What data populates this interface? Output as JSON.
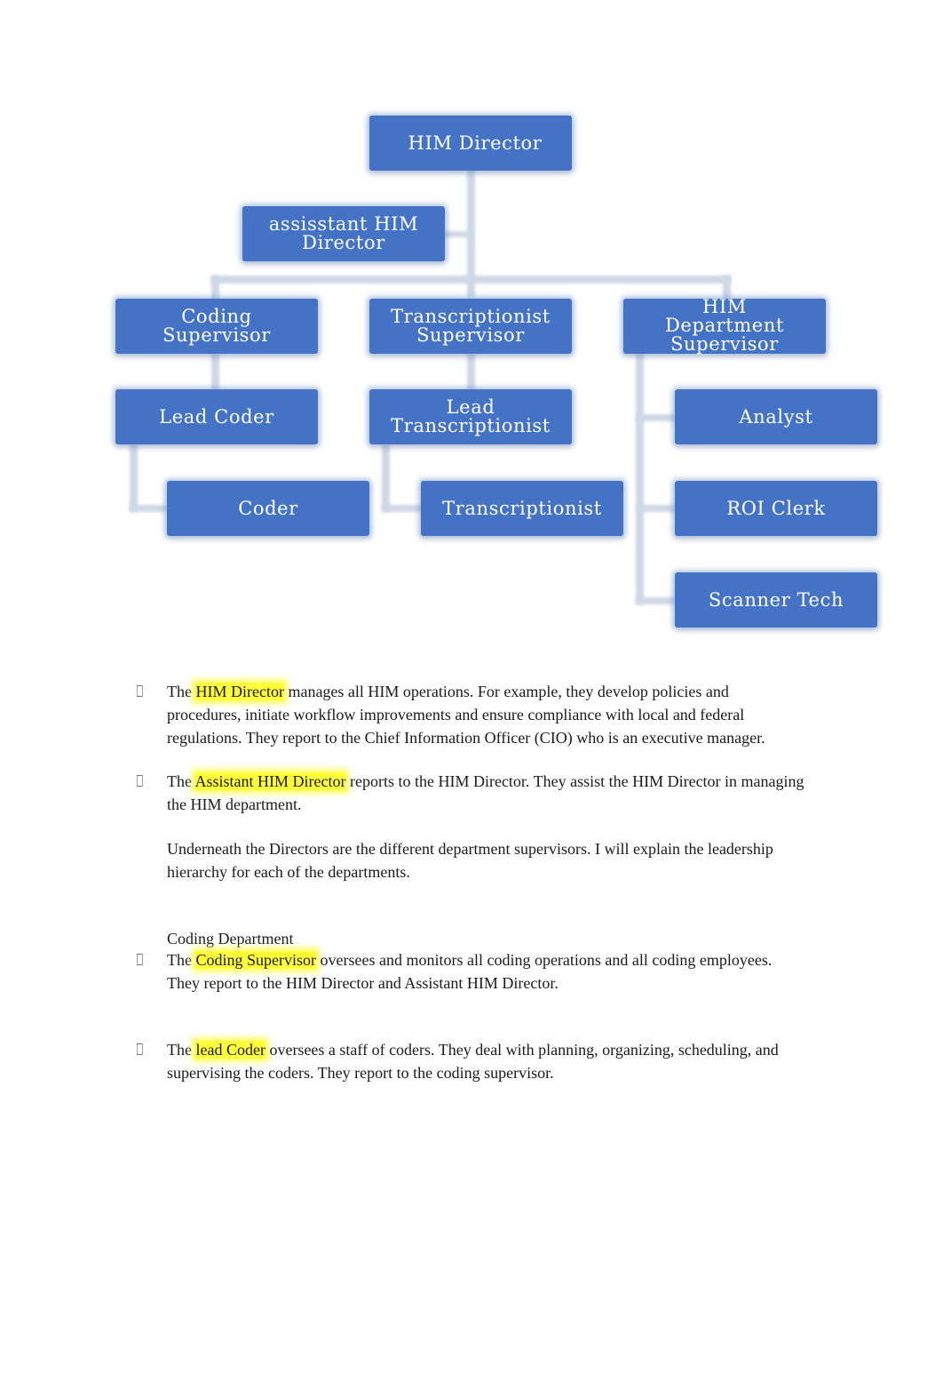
{
  "org_chart": {
    "node_color": "#4472c4",
    "connector_color": "#cfd8e6",
    "nodes": {
      "him_director": {
        "lines": [
          "HIM Director"
        ]
      },
      "assistant_director": {
        "lines": [
          "assisstant HIM",
          "Director"
        ]
      },
      "coding_supervisor": {
        "lines": [
          "Coding",
          "Supervisor"
        ]
      },
      "transcriptionist_supervisor": {
        "lines": [
          "Transcriptionist",
          "Supervisor"
        ]
      },
      "him_department_supervisor": {
        "lines": [
          "HIM",
          "Department",
          "Supervisor"
        ]
      },
      "lead_coder": {
        "lines": [
          "Lead Coder"
        ]
      },
      "lead_transcriptionist": {
        "lines": [
          "Lead",
          "Transcriptionist"
        ]
      },
      "coder": {
        "lines": [
          "Coder"
        ]
      },
      "transcriptionist": {
        "lines": [
          "Transcriptionist"
        ]
      },
      "analyst": {
        "lines": [
          "Analyst"
        ]
      },
      "roi_clerk": {
        "lines": [
          "ROI Clerk"
        ]
      },
      "scanner_tech": {
        "lines": [
          "Scanner Tech"
        ]
      }
    }
  },
  "body": {
    "highlight_color": "#ffff3a",
    "bullet_icon": "missing-glyph-box",
    "paragraphs": [
      {
        "prefix": "The ",
        "highlight": "HIM Director",
        "rest": " manages all HIM operations. For example, they develop policies and",
        "line2": "procedures, initiate workflow improvements and ensure compliance with local and federal",
        "line3": "regulations. They report to the Chief Information Officer (CIO) who is an executive manager."
      },
      {
        "prefix": "The ",
        "highlight": "Assistant HIM Director",
        "rest": " reports to the HIM Director. They assist the HIM Director in managing",
        "line2": "the HIM department."
      },
      {
        "line1": "Underneath the Directors are the different department supervisors. I will explain the leadership",
        "line2": "hierarchy for each of the departments."
      },
      {
        "heading": "Coding Department"
      },
      {
        "prefix": "The ",
        "highlight": "Coding Supervisor",
        "rest": " oversees and monitors all coding operations and all coding employees.",
        "line2": "They report to the HIM Director and Assistant HIM Director."
      },
      {
        "prefix": "The ",
        "highlight": "lead Coder",
        "rest": " oversees a staff of coders. They deal with planning, organizing, scheduling, and",
        "line2": "supervising the coders. They report to the coding supervisor."
      }
    ]
  }
}
